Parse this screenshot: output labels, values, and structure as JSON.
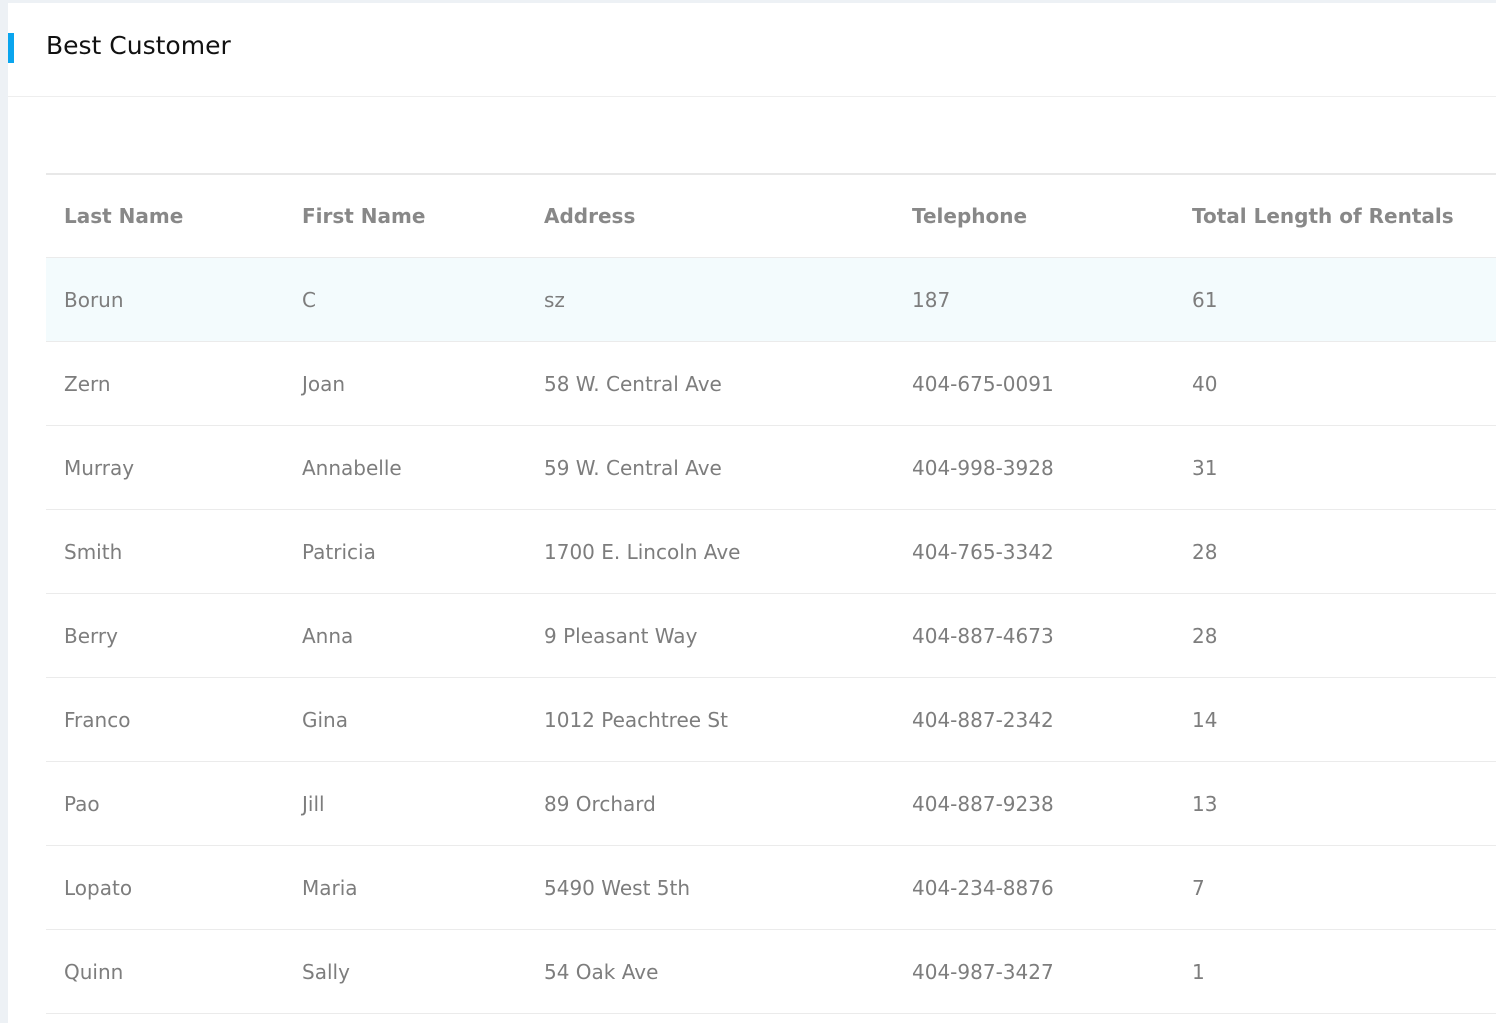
{
  "header": {
    "title": "Best Customer"
  },
  "table": {
    "columns": [
      "Last Name",
      "First Name",
      "Address",
      "Telephone",
      "Total Length of Rentals"
    ],
    "rows": [
      [
        "Borun",
        "C",
        "sz",
        "187",
        "61"
      ],
      [
        "Zern",
        "Joan",
        "58 W. Central Ave",
        "404-675-0091",
        "40"
      ],
      [
        "Murray",
        "Annabelle",
        "59 W. Central Ave",
        "404-998-3928",
        "31"
      ],
      [
        "Smith",
        "Patricia",
        "1700 E. Lincoln Ave",
        "404-765-3342",
        "28"
      ],
      [
        "Berry",
        "Anna",
        "9 Pleasant Way",
        "404-887-4673",
        "28"
      ],
      [
        "Franco",
        "Gina",
        "1012 Peachtree St",
        "404-887-2342",
        "14"
      ],
      [
        "Pao",
        "Jill",
        "89 Orchard",
        "404-887-9238",
        "13"
      ],
      [
        "Lopato",
        "Maria",
        "5490 West 5th",
        "404-234-8876",
        "7"
      ],
      [
        "Quinn",
        "Sally",
        "54 Oak Ave",
        "404-987-3427",
        "1"
      ]
    ]
  }
}
